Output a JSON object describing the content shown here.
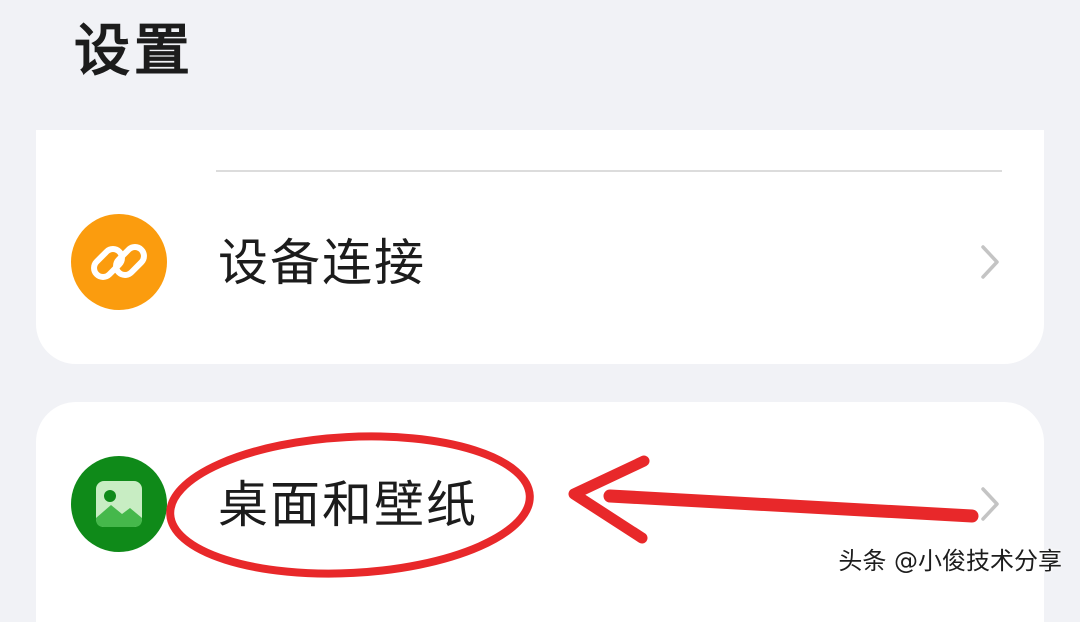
{
  "header": {
    "title": "设置"
  },
  "settings": {
    "device_connection": {
      "label": "设备连接",
      "icon": "link-icon",
      "icon_color": "#fb9c0e"
    },
    "desktop_wallpaper": {
      "label": "桌面和壁纸",
      "icon": "image-icon",
      "icon_color": "#0f8a19"
    }
  },
  "annotation": {
    "color": "#e8282a",
    "shapes": [
      "ellipse",
      "arrow"
    ]
  },
  "watermark": {
    "text": "头条 @小俊技术分享"
  },
  "colors": {
    "background": "#f1f2f6",
    "card": "#ffffff"
  }
}
